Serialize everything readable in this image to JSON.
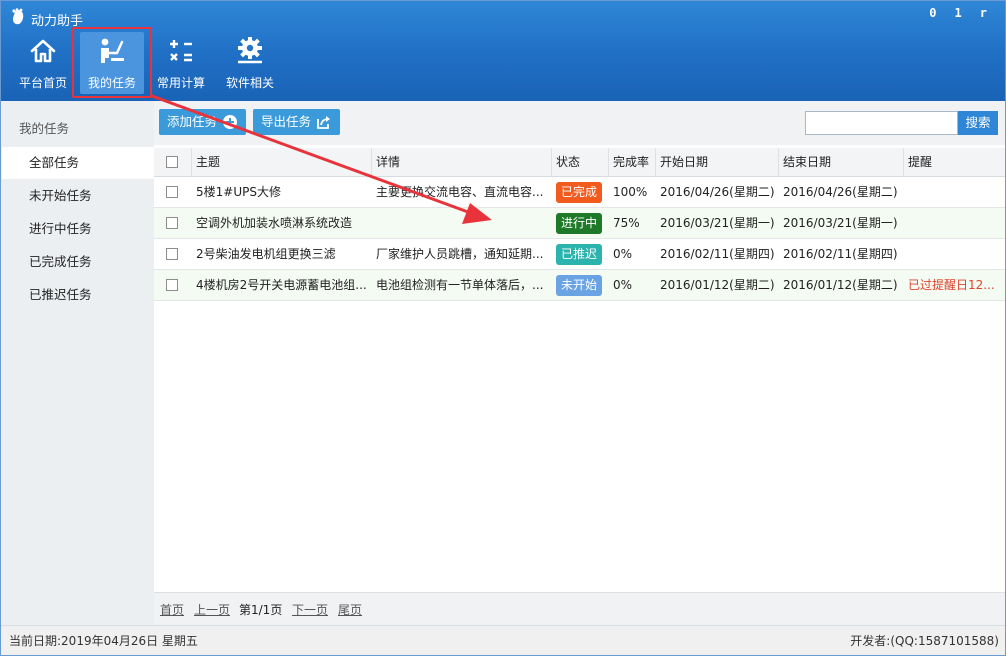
{
  "window": {
    "title": "动力助手",
    "controls": [
      "0",
      "1",
      "r"
    ]
  },
  "toolbar": {
    "items": [
      {
        "label": "平台首页",
        "icon": "home-icon"
      },
      {
        "label": "我的任务",
        "icon": "task-icon"
      },
      {
        "label": "常用计算",
        "icon": "calculator-icon"
      },
      {
        "label": "软件相关",
        "icon": "gear-icon"
      }
    ]
  },
  "sidebar": {
    "title": "我的任务",
    "items": [
      "全部任务",
      "未开始任务",
      "进行中任务",
      "已完成任务",
      "已推迟任务"
    ]
  },
  "actions": {
    "add_label": "添加任务",
    "export_label": "导出任务",
    "search_placeholder": "",
    "search_label": "搜索"
  },
  "table": {
    "columns": [
      "主题",
      "详情",
      "状态",
      "完成率",
      "开始日期",
      "结束日期",
      "提醒"
    ],
    "rows": [
      {
        "subject": "5楼1#UPS大修",
        "detail": "主要更换交流电容、直流电容...",
        "status": "已完成",
        "status_color": "#f25a1e",
        "rate": "100%",
        "start": "2016/04/26(星期二)",
        "end": "2016/04/26(星期二)",
        "remind": ""
      },
      {
        "subject": "空调外机加装水喷淋系统改造",
        "detail": "",
        "status": "进行中",
        "status_color": "#1e7a28",
        "rate": "75%",
        "start": "2016/03/21(星期一)",
        "end": "2016/03/21(星期一)",
        "remind": ""
      },
      {
        "subject": "2号柴油发电机组更换三滤",
        "detail": "厂家维护人员跳槽，通知延期...",
        "status": "已推迟",
        "status_color": "#2bb3ad",
        "rate": "0%",
        "start": "2016/02/11(星期四)",
        "end": "2016/02/11(星期四)",
        "remind": ""
      },
      {
        "subject": "4楼机房2号开关电源蓄电池组...",
        "detail": "电池组检测有一节单体落后，...",
        "status": "未开始",
        "status_color": "#6aa3e3",
        "rate": "0%",
        "start": "2016/01/12(星期二)",
        "end": "2016/01/12(星期二)",
        "remind": "已过提醒日12..."
      }
    ]
  },
  "pager": {
    "first": "首页",
    "prev": "上一页",
    "current": "第1/1页",
    "next": "下一页",
    "last": "尾页"
  },
  "status": {
    "date": "当前日期:2019年04月26日 星期五",
    "developer": "开发者:(QQ:1587101588)"
  },
  "colors": {
    "accent": "#2f86d6",
    "highlight": "#e8333a",
    "remind": "#e0442d"
  }
}
